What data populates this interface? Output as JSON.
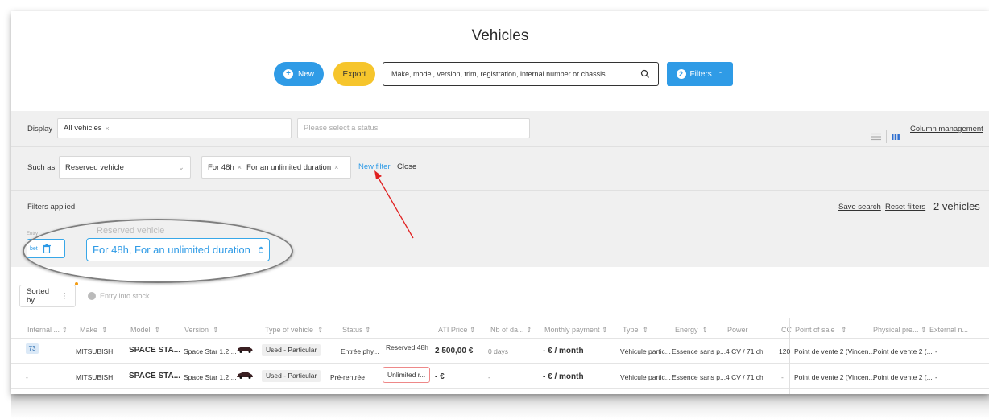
{
  "page": {
    "title": "Vehicles"
  },
  "toolbar": {
    "new_label": "New",
    "export_label": "Export",
    "search_placeholder": "Make, model, version, trim, registration, internal number or chassis",
    "filters_label": "Filters",
    "filters_count": "2"
  },
  "filters": {
    "display_label": "Display",
    "display_tag": "All vehicles",
    "status_placeholder": "Please select a status",
    "column_management": "Column management",
    "such_as_label": "Such as",
    "such_as_value": "Reserved vehicle",
    "duration_tags": [
      "For 48h",
      "For an unlimited duration"
    ],
    "new_filter": "New filter",
    "close": "Close",
    "applied_label": "Filters applied",
    "save_search": "Save search",
    "reset_filters": "Reset filters",
    "result_count": "2 vehicles",
    "applied_chip_title": "Reserved vehicle",
    "applied_chip_value": "For 48h, For an unlimited duration",
    "small_chip_title": "Entry",
    "small_chip_value": "bet"
  },
  "sorting": {
    "sorted_by": "Sorted by",
    "entry_into_stock": "Entry into stock"
  },
  "table": {
    "headers": [
      "Internal ...",
      "Make",
      "Model",
      "Version",
      "Type of vehicle",
      "Status",
      "ATI Price",
      "Nb of da...",
      "Monthly payment",
      "Type",
      "Energy",
      "Power",
      "CC",
      "Point of sale",
      "Physical pre...",
      "External n..."
    ],
    "rows": [
      {
        "internal": "73",
        "make": "MITSUBISHI",
        "model": "SPACE STA...",
        "version": "Space Star 1.2 ...",
        "type_of_vehicle": "Used - Particular",
        "status": "Entrée phy...",
        "reservation": "Reserved 48h",
        "price": "2 500,00 €",
        "days": "0 days",
        "monthly": "- € / month",
        "type": "Véhicule partic...",
        "energy": "Essence sans p...",
        "power": "4 CV / 71 ch",
        "cc": "120",
        "point_of_sale": "Point de vente 2 (Vincen...",
        "physical": "Point de vente 2 (...",
        "external": "-"
      },
      {
        "internal": "-",
        "make": "MITSUBISHI",
        "model": "SPACE STA...",
        "version": "Space Star 1.2 ...",
        "type_of_vehicle": "Used - Particular",
        "status": "Pré-rentrée",
        "reservation": "Unlimited r...",
        "price": "- €",
        "days": "-",
        "monthly": "- € / month",
        "type": "Véhicule partic...",
        "energy": "Essence sans p...",
        "power": "4 CV / 71 ch",
        "cc": "-",
        "point_of_sale": "Point de vente 2 (Vincen...",
        "physical": "Point de vente 2 (...",
        "external": "-"
      }
    ]
  },
  "colors": {
    "accent": "#2f9be6",
    "export": "#f6c52c",
    "arrow": "#e02020"
  }
}
